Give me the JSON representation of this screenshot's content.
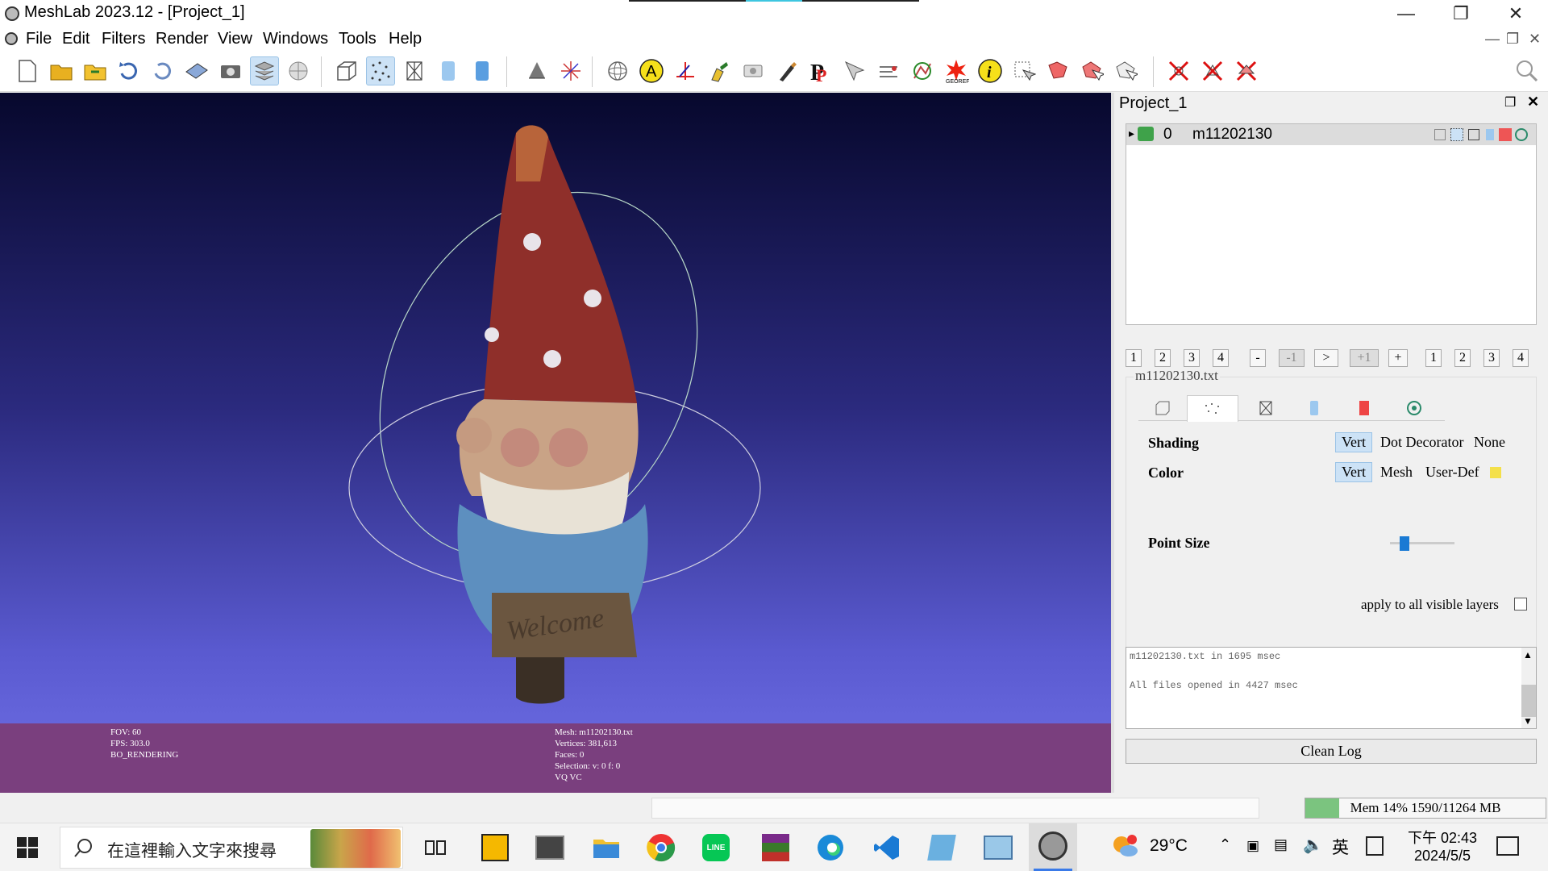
{
  "window": {
    "title": "MeshLab 2023.12 - [Project_1]"
  },
  "menu": [
    "File",
    "Edit",
    "Filters",
    "Render",
    "View",
    "Windows",
    "Tools",
    "Help"
  ],
  "viewport": {
    "info_left": {
      "fov": "FOV: 60",
      "fps": "FPS:  303.0",
      "mode": "BO_RENDERING"
    },
    "info_mid": {
      "mesh": "Mesh: m11202130.txt",
      "vertices": "Vertices: 381,613",
      "faces": "Faces: 0",
      "selection": "Selection: v: 0 f: 0",
      "attrs": "VQ VC"
    },
    "sign_text": "Welcome"
  },
  "panel": {
    "title": "Project_1",
    "layer": {
      "index": "0",
      "name": "m11202130"
    },
    "nav_buttons_left": [
      "1",
      "2",
      "3",
      "4"
    ],
    "nav_buttons_mid": [
      "-",
      "-1",
      ">",
      "+1",
      "+"
    ],
    "nav_buttons_right": [
      "1",
      "2",
      "3",
      "4"
    ],
    "file_label": "m11202130.txt",
    "shading": {
      "label": "Shading",
      "options": [
        "Vert",
        "Dot Decorator",
        "None"
      ],
      "selected": "Vert"
    },
    "color": {
      "label": "Color",
      "options": [
        "Vert",
        "Mesh",
        "User-Def"
      ],
      "selected": "Vert",
      "user_color": "#f4e04a"
    },
    "point_size": {
      "label": "Point Size",
      "value": 0.15
    },
    "apply_all": "apply to all visible layers",
    "log": [
      "m11202130.txt in 1695 msec",
      "All files opened in 4427 msec"
    ],
    "clean_log": "Clean Log"
  },
  "statusbar": {
    "mem": "Mem 14% 1590/11264 MB",
    "mem_percent": 14
  },
  "taskbar": {
    "search_placeholder": "在這裡輸入文字來搜尋",
    "weather": "29°C",
    "ime": "英",
    "time": "下午 02:43",
    "date": "2024/5/5"
  },
  "colors": {
    "viewport_bottom": "#7070e6",
    "infobar": "#7a3f7e",
    "selected_btn": "#cce2f6",
    "mem_bar": "#7bc47f"
  }
}
